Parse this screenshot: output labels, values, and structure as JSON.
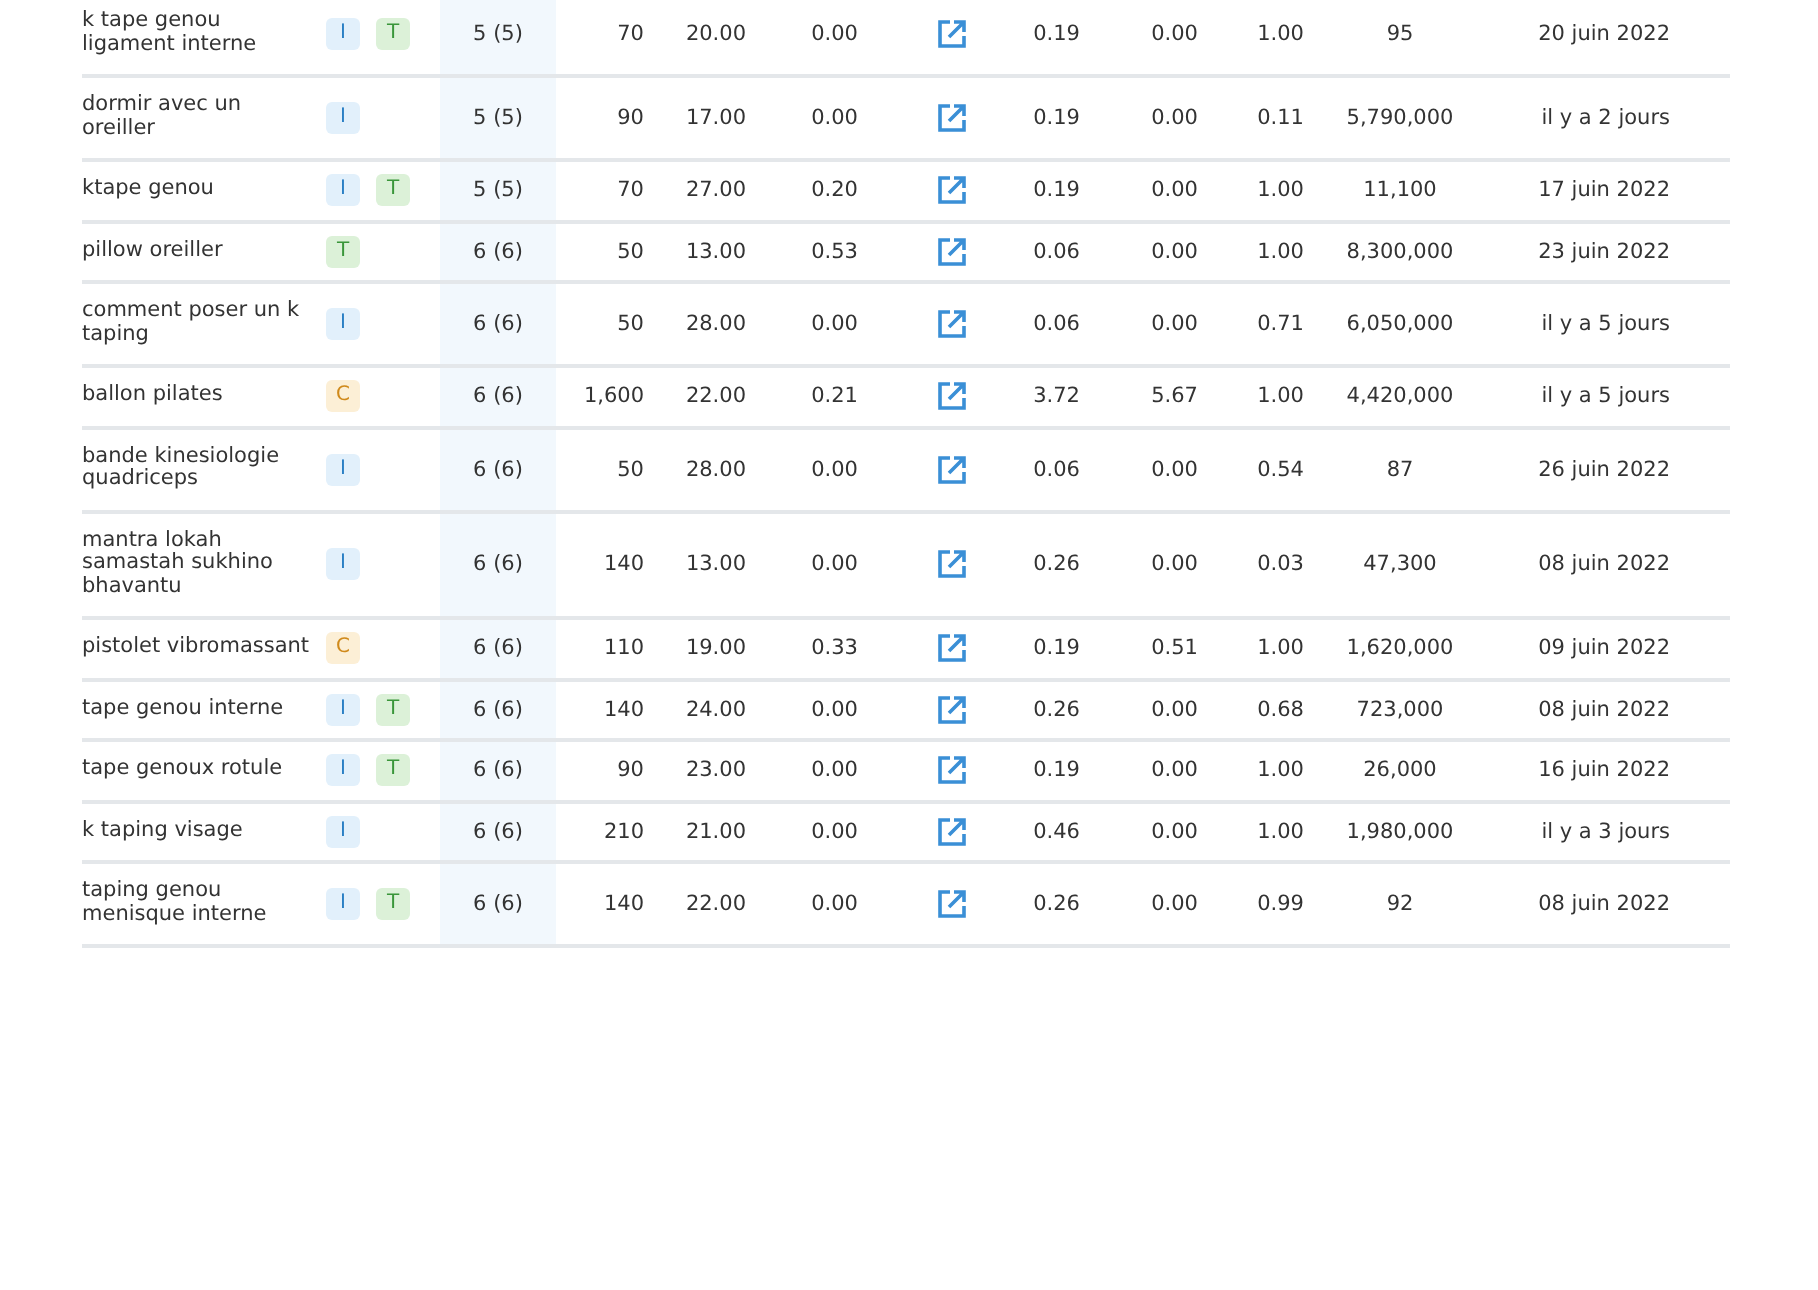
{
  "table": {
    "rows": [
      {
        "column_1": "k tape genou ligament interne",
        "column_2": [
          {
            "label": "I",
            "kind": "info"
          },
          {
            "label": "T",
            "kind": "trans"
          }
        ],
        "column_3": "5 (5)",
        "column_4": "70",
        "column_5": "20.00",
        "column_6": "0.00",
        "column_8": "0.19",
        "column_9": "0.00",
        "column_10": "1.00",
        "column_11": "95",
        "column_12": "20 juin 2022"
      },
      {
        "column_1": "dormir avec un oreiller",
        "column_2": [
          {
            "label": "I",
            "kind": "info"
          }
        ],
        "column_3": "5 (5)",
        "column_4": "90",
        "column_5": "17.00",
        "column_6": "0.00",
        "column_8": "0.19",
        "column_9": "0.00",
        "column_10": "0.11",
        "column_11": "5,790,000",
        "column_12": "il y a 2 jours"
      },
      {
        "column_1": "ktape genou",
        "column_2": [
          {
            "label": "I",
            "kind": "info"
          },
          {
            "label": "T",
            "kind": "trans"
          }
        ],
        "column_3": "5 (5)",
        "column_4": "70",
        "column_5": "27.00",
        "column_6": "0.20",
        "column_8": "0.19",
        "column_9": "0.00",
        "column_10": "1.00",
        "column_11": "11,100",
        "column_12": "17 juin 2022"
      },
      {
        "column_1": "pillow oreiller",
        "column_2": [
          {
            "label": "T",
            "kind": "trans"
          }
        ],
        "column_3": "6 (6)",
        "column_4": "50",
        "column_5": "13.00",
        "column_6": "0.53",
        "column_8": "0.06",
        "column_9": "0.00",
        "column_10": "1.00",
        "column_11": "8,300,000",
        "column_12": "23 juin 2022"
      },
      {
        "column_1": "comment poser un k taping",
        "column_2": [
          {
            "label": "I",
            "kind": "info"
          }
        ],
        "column_3": "6 (6)",
        "column_4": "50",
        "column_5": "28.00",
        "column_6": "0.00",
        "column_8": "0.06",
        "column_9": "0.00",
        "column_10": "0.71",
        "column_11": "6,050,000",
        "column_12": "il y a 5 jours"
      },
      {
        "column_1": "ballon pilates",
        "column_2": [
          {
            "label": "C",
            "kind": "comm"
          }
        ],
        "column_3": "6 (6)",
        "column_4": "1,600",
        "column_5": "22.00",
        "column_6": "0.21",
        "column_8": "3.72",
        "column_9": "5.67",
        "column_10": "1.00",
        "column_11": "4,420,000",
        "column_12": "il y a 5 jours"
      },
      {
        "column_1": "bande kinesiologie quadriceps",
        "column_2": [
          {
            "label": "I",
            "kind": "info"
          }
        ],
        "column_3": "6 (6)",
        "column_4": "50",
        "column_5": "28.00",
        "column_6": "0.00",
        "column_8": "0.06",
        "column_9": "0.00",
        "column_10": "0.54",
        "column_11": "87",
        "column_12": "26 juin 2022"
      },
      {
        "column_1": "mantra lokah samastah sukhino bhavantu",
        "column_2": [
          {
            "label": "I",
            "kind": "info"
          }
        ],
        "column_3": "6 (6)",
        "column_4": "140",
        "column_5": "13.00",
        "column_6": "0.00",
        "column_8": "0.26",
        "column_9": "0.00",
        "column_10": "0.03",
        "column_11": "47,300",
        "column_12": "08 juin 2022"
      },
      {
        "column_1": "pistolet vibromassant",
        "column_2": [
          {
            "label": "C",
            "kind": "comm"
          }
        ],
        "column_3": "6 (6)",
        "column_4": "110",
        "column_5": "19.00",
        "column_6": "0.33",
        "column_8": "0.19",
        "column_9": "0.51",
        "column_10": "1.00",
        "column_11": "1,620,000",
        "column_12": "09 juin 2022"
      },
      {
        "column_1": "tape genou interne",
        "column_2": [
          {
            "label": "I",
            "kind": "info"
          },
          {
            "label": "T",
            "kind": "trans"
          }
        ],
        "column_3": "6 (6)",
        "column_4": "140",
        "column_5": "24.00",
        "column_6": "0.00",
        "column_8": "0.26",
        "column_9": "0.00",
        "column_10": "0.68",
        "column_11": "723,000",
        "column_12": "08 juin 2022"
      },
      {
        "column_1": "tape genoux rotule",
        "column_2": [
          {
            "label": "I",
            "kind": "info"
          },
          {
            "label": "T",
            "kind": "trans"
          }
        ],
        "column_3": "6 (6)",
        "column_4": "90",
        "column_5": "23.00",
        "column_6": "0.00",
        "column_8": "0.19",
        "column_9": "0.00",
        "column_10": "1.00",
        "column_11": "26,000",
        "column_12": "16 juin 2022"
      },
      {
        "column_1": "k taping visage",
        "column_2": [
          {
            "label": "I",
            "kind": "info"
          }
        ],
        "column_3": "6 (6)",
        "column_4": "210",
        "column_5": "21.00",
        "column_6": "0.00",
        "column_8": "0.46",
        "column_9": "0.00",
        "column_10": "1.00",
        "column_11": "1,980,000",
        "column_12": "il y a 3 jours"
      },
      {
        "column_1": "taping genou menisque interne",
        "column_2": [
          {
            "label": "I",
            "kind": "info"
          },
          {
            "label": "T",
            "kind": "trans"
          }
        ],
        "column_3": "6 (6)",
        "column_4": "140",
        "column_5": "22.00",
        "column_6": "0.00",
        "column_8": "0.26",
        "column_9": "0.00",
        "column_10": "0.99",
        "column_11": "92",
        "column_12": "08 juin 2022"
      }
    ]
  }
}
